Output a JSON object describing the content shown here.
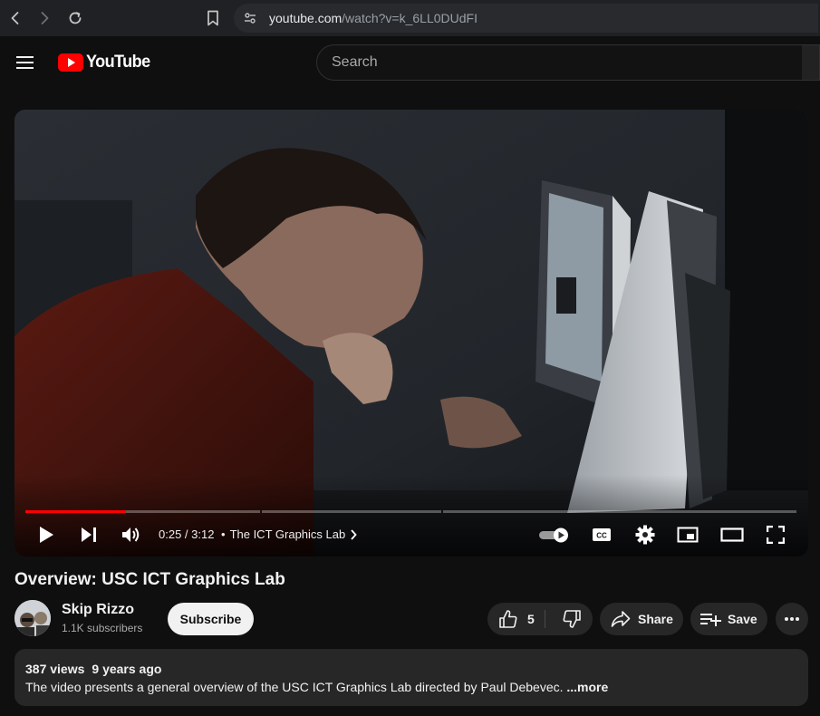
{
  "browser": {
    "url_domain": "youtube.com",
    "url_path": "/watch?v=k_6LL0DUdFI"
  },
  "header": {
    "logo_text": "YouTube",
    "search_placeholder": "Search"
  },
  "player": {
    "time_current": "0:25",
    "time_separator": " / ",
    "time_total": "3:12",
    "chapter_bullet": "•",
    "chapter_title": "The ICT Graphics Lab",
    "progress_fraction": 0.13,
    "accent_color": "#ff0000"
  },
  "video": {
    "title": "Overview: USC ICT Graphics Lab"
  },
  "channel": {
    "name": "Skip Rizzo",
    "subscribers": "1.1K subscribers",
    "subscribe_label": "Subscribe"
  },
  "actions": {
    "like_count": "5",
    "share_label": "Share",
    "save_label": "Save"
  },
  "description": {
    "views": "387 views",
    "age": "9 years ago",
    "text": "The video presents a general overview of the USC ICT Graphics Lab directed by Paul Debevec. ",
    "more_label": "...more"
  },
  "icons": {
    "back": "back-arrow-icon",
    "forward": "forward-arrow-icon",
    "reload": "reload-icon",
    "bookmark": "bookmark-icon",
    "site_info": "tune-icon",
    "menu": "hamburger-icon",
    "play": "play-icon",
    "next": "next-icon",
    "volume": "volume-icon",
    "autoplay": "autoplay-toggle-icon",
    "captions": "cc-icon",
    "settings": "gear-icon",
    "miniplayer": "miniplayer-icon",
    "theater": "theater-icon",
    "fullscreen": "fullscreen-icon",
    "like": "thumbs-up-icon",
    "dislike": "thumbs-down-icon",
    "share": "share-icon",
    "save": "playlist-add-icon",
    "more": "more-dots-icon"
  }
}
